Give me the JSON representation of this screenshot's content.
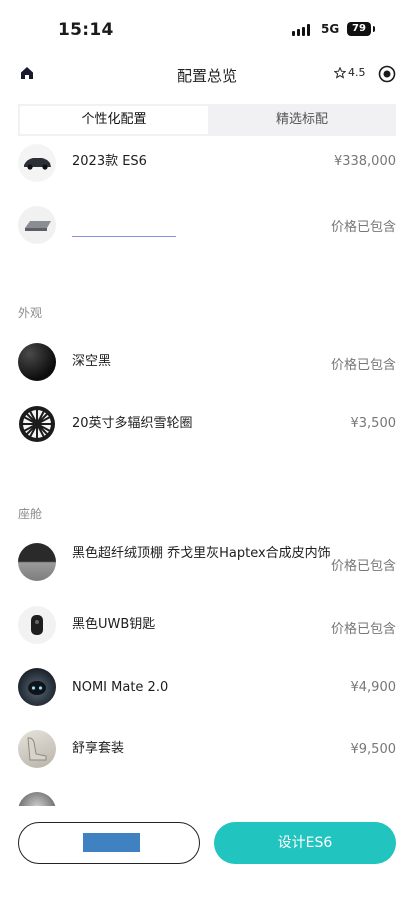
{
  "status_bar": {
    "time": "15:14",
    "network": "5G",
    "battery": "79"
  },
  "nav": {
    "title": "配置总览",
    "rating": "4.5"
  },
  "tabs": [
    {
      "label": "个性化配置",
      "active": true
    },
    {
      "label": "精选标配",
      "active": false
    }
  ],
  "items_top": [
    {
      "name": "2023款 ES6",
      "price": "¥338,000"
    },
    {
      "name": "",
      "price": "价格已包含"
    }
  ],
  "sections": {
    "exterior": {
      "label": "外观",
      "items": [
        {
          "name": "深空黑",
          "price": "价格已包含"
        },
        {
          "name": "20英寸多辐织雪轮圈",
          "price": "¥3,500"
        }
      ]
    },
    "cabin": {
      "label": "座舱",
      "items": [
        {
          "name": "黑色超纤绒顶棚 乔戈里灰Haptex合成皮内饰",
          "price": "价格已包含"
        },
        {
          "name": "黑色UWB钥匙",
          "price": "价格已包含"
        },
        {
          "name": "NOMI Mate 2.0",
          "price": "¥4,900"
        },
        {
          "name": "舒享套装",
          "price": "¥9,500"
        }
      ]
    }
  },
  "buttons": {
    "primary": "设计ES6"
  },
  "colors": {
    "accent": "#22c4c0",
    "redaction": "#3f81c1",
    "price_text": "#777777"
  }
}
